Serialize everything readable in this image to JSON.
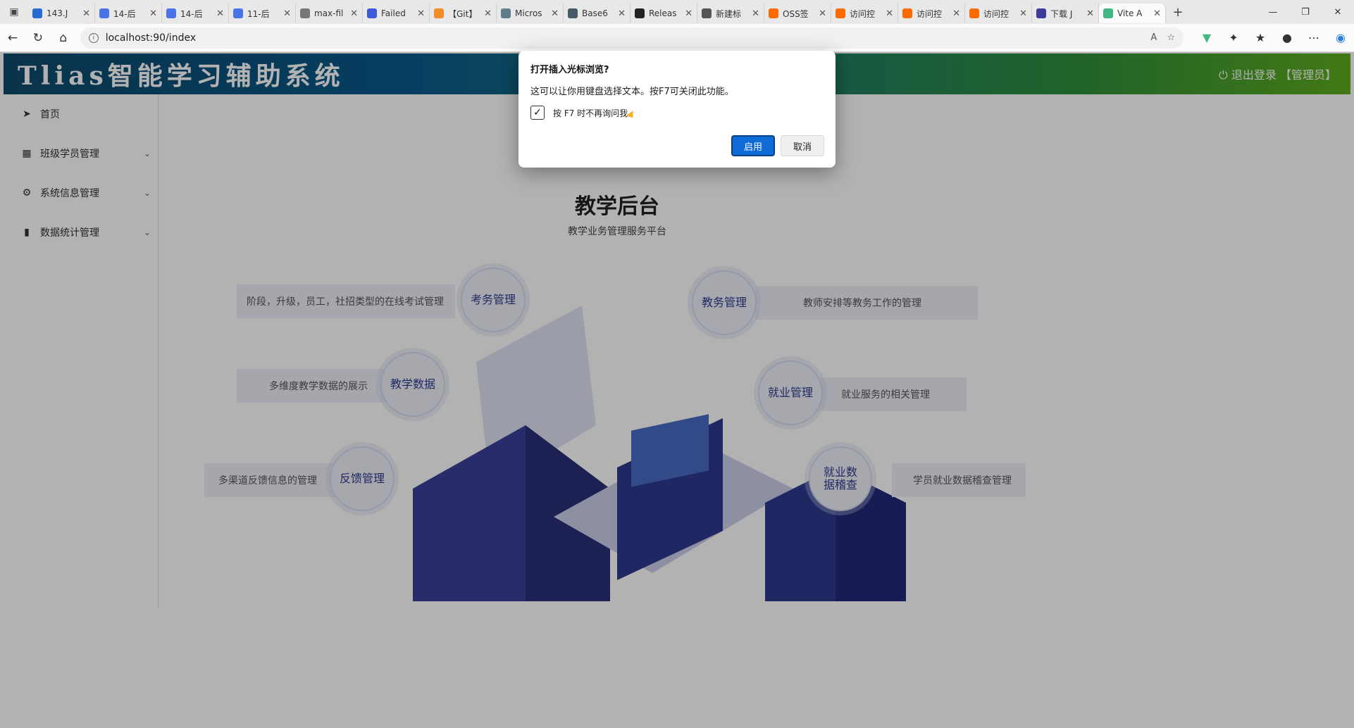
{
  "browser": {
    "tabs": [
      {
        "title": "143.J",
        "color": "#2a6bd1"
      },
      {
        "title": "14-后",
        "color": "#4a73e8"
      },
      {
        "title": "14-后",
        "color": "#4a73e8"
      },
      {
        "title": "11-后",
        "color": "#4a73e8"
      },
      {
        "title": "max-fil",
        "color": "#777777"
      },
      {
        "title": "Failed",
        "color": "#3b5bdb"
      },
      {
        "title": "【Git】",
        "color": "#f28c28"
      },
      {
        "title": "Micros",
        "color": "#607d8b"
      },
      {
        "title": "Base6",
        "color": "#455a64"
      },
      {
        "title": "Releas",
        "color": "#222222"
      },
      {
        "title": "新建标",
        "color": "#555555"
      },
      {
        "title": "OSS签",
        "color": "#ff6a00"
      },
      {
        "title": "访问控",
        "color": "#ff6a00"
      },
      {
        "title": "访问控",
        "color": "#ff6a00"
      },
      {
        "title": "访问控",
        "color": "#ff6a00"
      },
      {
        "title": "下载 J",
        "color": "#3b3b98"
      },
      {
        "title": "Vite A",
        "color": "#41b883"
      }
    ],
    "url": "localhost:90/index"
  },
  "app": {
    "brand": "Tlias智能学习辅助系统",
    "logout": "退出登录 【管理员】",
    "menu": [
      {
        "label": "首页",
        "icon": "paper-plane-icon",
        "glyph": "➤"
      },
      {
        "label": "班级学员管理",
        "icon": "grid-icon",
        "glyph": "▦"
      },
      {
        "label": "系统信息管理",
        "icon": "gear-icon",
        "glyph": "⚙"
      },
      {
        "label": "数据统计管理",
        "icon": "bar-chart-icon",
        "glyph": "▮"
      }
    ],
    "hero": {
      "title": "教学后台",
      "subtitle": "教学业务管理服务平台"
    },
    "features": [
      {
        "name": "考务管理",
        "desc": "阶段，升级，员工，社招类型的在线考试管理"
      },
      {
        "name": "教务管理",
        "desc": "教师安排等教务工作的管理"
      },
      {
        "name": "教学数据",
        "desc": "多维度教学数据的展示"
      },
      {
        "name": "就业管理",
        "desc": "就业服务的相关管理"
      },
      {
        "name": "反馈管理",
        "desc": "多渠道反馈信息的管理"
      },
      {
        "name": "就业数据稽查",
        "desc": "学员就业数据稽查管理"
      }
    ]
  },
  "dialog": {
    "title": "打开插入光标浏览?",
    "message": "这可以让你用键盘选择文本。按F7可关闭此功能。",
    "checkbox_label": "按 F7 时不再询问我",
    "checkbox_checked": true,
    "enable_label": "启用",
    "cancel_label": "取消"
  }
}
